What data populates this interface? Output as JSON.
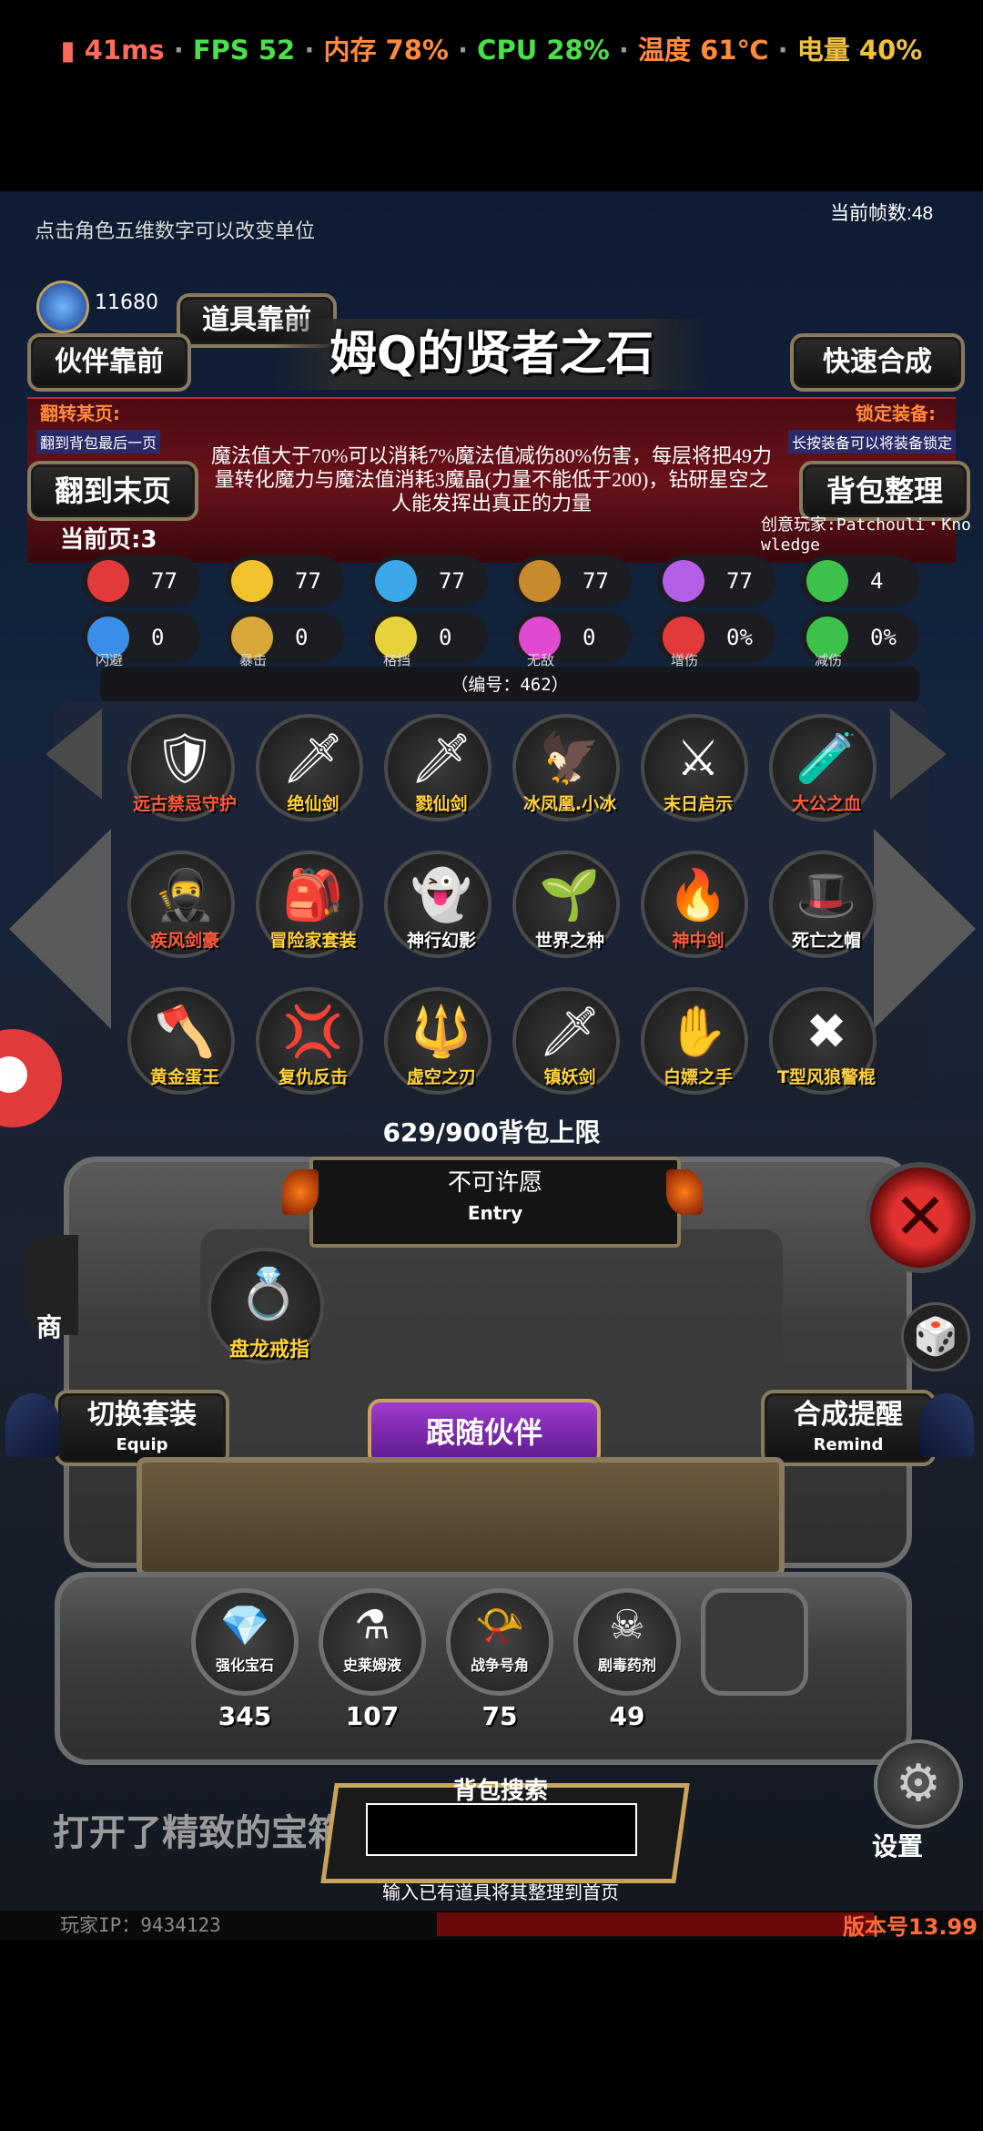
{
  "status_bar": {
    "ping": "41ms",
    "fps": "FPS 52",
    "memory": "内存 78%",
    "cpu": "CPU 28%",
    "temp": "温度 61℃",
    "battery": "电量 40%",
    "sep": " · "
  },
  "hud": {
    "hint": "点击角色五维数字可以改变单位",
    "frame_rate": "当前帧数:48",
    "crystal_count": "11680",
    "player_ip": "玩家IP：9434123",
    "version": "版本号13.99",
    "log_text": "打开了精致的宝箱"
  },
  "buttons": {
    "item_prev": "道具靠前",
    "partner_prev": "伙伴靠前",
    "quick_craft": "快速合成",
    "flip_to_last": "翻到末页",
    "sort_bag": "背包整理",
    "switch_set": "切换套装",
    "switch_set_sub": "Equip",
    "craft_remind": "合成提醒",
    "craft_remind_sub": "Remind",
    "follow_partner": "跟随伙伴",
    "settings": "设置",
    "shop_partial": "商"
  },
  "item_panel": {
    "title": "姆Q的贤者之石",
    "flip_page_label": "翻转某页:",
    "flip_page_sub": "翻到背包最后一页",
    "lock_equip_label": "锁定装备:",
    "lock_equip_sub": "长按装备可以将装备锁定",
    "description": "魔法值大于70%可以消耗7%魔法值减伤80%伤害，每层将把49力量转化魔力与魔法值消耗3魔晶(力量不能低于200)，钻研星空之人能发挥出真正的力量",
    "current_page": "当前页:3",
    "creator": "创意玩家:Patchouli・Knowledge",
    "serial": "（编号：462）"
  },
  "stats_row1": [
    {
      "icon": "heart-icon",
      "value": "77",
      "color": "#e23a3a"
    },
    {
      "icon": "strength-icon",
      "value": "77",
      "color": "#f2c12e"
    },
    {
      "icon": "boot-icon",
      "value": "77",
      "color": "#3aa7e8"
    },
    {
      "icon": "sword-icon",
      "value": "77",
      "color": "#c98a2d"
    },
    {
      "icon": "lightning-icon",
      "value": "77",
      "color": "#b45ee8"
    },
    {
      "icon": "clover-icon",
      "value": "4",
      "color": "#3cc24a"
    }
  ],
  "stats_row2": [
    {
      "icon": "dodge-icon",
      "value": "0",
      "label": "闪避",
      "color": "#3a8fe8"
    },
    {
      "icon": "crit-icon",
      "value": "0",
      "label": "暴击",
      "color": "#d9a83a"
    },
    {
      "icon": "block-icon",
      "value": "0",
      "label": "格挡",
      "color": "#e6d23a"
    },
    {
      "icon": "invincible-icon",
      "value": "0",
      "label": "无敌",
      "color": "#e04ad0"
    },
    {
      "icon": "damage-up-icon",
      "value": "0%",
      "label": "增伤",
      "color": "#e23a3a"
    },
    {
      "icon": "damage-down-icon",
      "value": "0%",
      "label": "减伤",
      "color": "#3cc24a"
    }
  ],
  "inventory": [
    {
      "name": "远古禁忌守护",
      "color": "red",
      "icon": "guardian-icon",
      "glyph": "🛡"
    },
    {
      "name": "绝仙剑",
      "color": "yellow",
      "icon": "sword-icon",
      "glyph": "🗡"
    },
    {
      "name": "戮仙剑",
      "color": "yellow",
      "icon": "sword-icon",
      "glyph": "🗡"
    },
    {
      "name": "冰凤凰.小冰",
      "color": "yellow",
      "icon": "phoenix-icon",
      "glyph": "🦅"
    },
    {
      "name": "末日启示",
      "color": "yellow",
      "icon": "axe-icon",
      "glyph": "⚔"
    },
    {
      "name": "大公之血",
      "color": "red",
      "icon": "potion-icon",
      "glyph": "🧪"
    },
    {
      "name": "疾风剑豪",
      "color": "red",
      "icon": "swordsman-icon",
      "glyph": "🥷"
    },
    {
      "name": "冒险家套装",
      "color": "yellow",
      "icon": "armor-icon",
      "glyph": "🎒"
    },
    {
      "name": "神行幻影",
      "color": "white",
      "icon": "phantom-icon",
      "glyph": "👻"
    },
    {
      "name": "世界之种",
      "color": "white",
      "icon": "seed-icon",
      "glyph": "🌱"
    },
    {
      "name": "神中剑",
      "color": "red",
      "icon": "flame-sword-icon",
      "glyph": "🔥"
    },
    {
      "name": "死亡之帽",
      "color": "white",
      "icon": "hat-icon",
      "glyph": "🎩"
    },
    {
      "name": "黄金蛋王",
      "color": "yellow",
      "icon": "golden-blade-icon",
      "glyph": "🪓"
    },
    {
      "name": "复仇反击",
      "color": "yellow",
      "icon": "revenge-icon",
      "glyph": "💢"
    },
    {
      "name": "虚空之刃",
      "color": "yellow",
      "icon": "void-blade-icon",
      "glyph": "🔱"
    },
    {
      "name": "镇妖剑",
      "color": "yellow",
      "icon": "sword-icon",
      "glyph": "🗡"
    },
    {
      "name": "白嫖之手",
      "color": "yellow",
      "icon": "hand-icon",
      "glyph": "✋"
    },
    {
      "name": "T型风狼警棍",
      "color": "yellow",
      "icon": "baton-icon",
      "glyph": "✖"
    }
  ],
  "bag": {
    "capacity": "629/900背包上限",
    "wish_label": "不可许愿",
    "wish_sub": "Entry"
  },
  "equipped": {
    "name": "盘龙戒指",
    "icon": "ring-icon",
    "glyph": "💍"
  },
  "materials": [
    {
      "name": "强化宝石",
      "count": "345",
      "icon": "gem-icon",
      "glyph": "💎"
    },
    {
      "name": "史莱姆液",
      "count": "107",
      "icon": "slime-flask-icon",
      "glyph": "⚗"
    },
    {
      "name": "战争号角",
      "count": "75",
      "icon": "horn-icon",
      "glyph": "📯"
    },
    {
      "name": "剧毒药剂",
      "count": "49",
      "icon": "poison-icon",
      "glyph": "☠"
    }
  ],
  "search": {
    "title": "背包搜索",
    "hint": "输入已有道具将其整理到首页",
    "value": ""
  }
}
